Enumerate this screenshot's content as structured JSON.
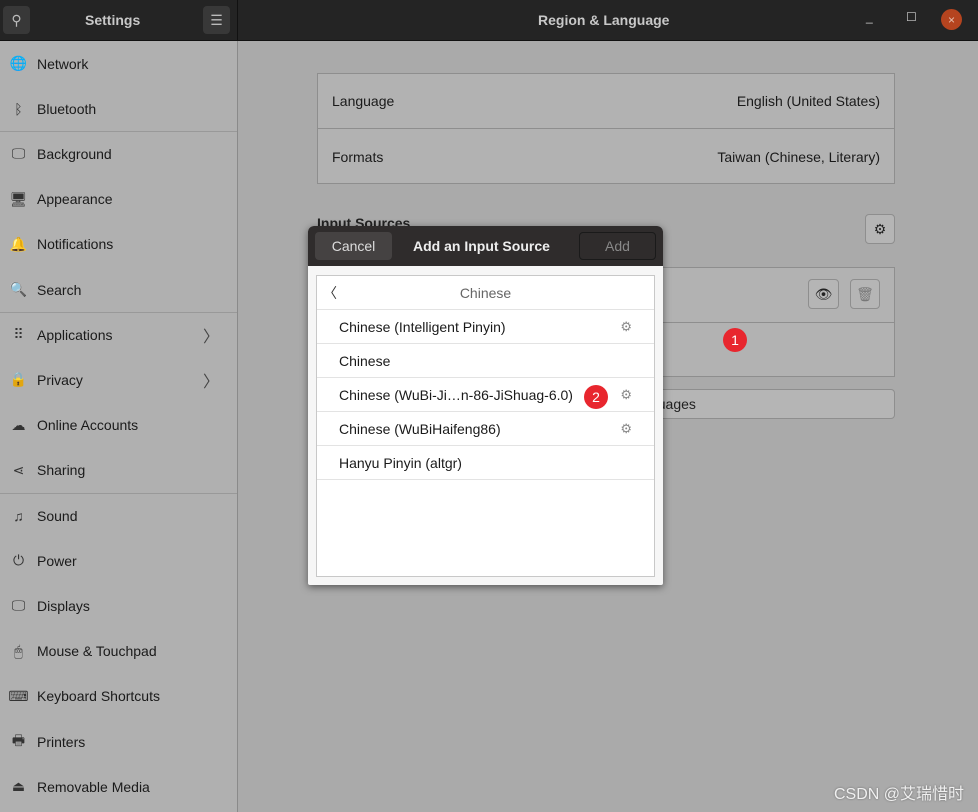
{
  "titlebar": {
    "app_title": "Settings",
    "panel_title": "Region & Language",
    "minimize": "_",
    "maximize": "☐",
    "close": "×"
  },
  "sidebar": {
    "items": [
      {
        "label": "Network",
        "icon": "🌐"
      },
      {
        "label": "Bluetooth",
        "icon": "ᛒ"
      },
      {
        "label": "Background",
        "icon": "🖵"
      },
      {
        "label": "Appearance",
        "icon": "🖥"
      },
      {
        "label": "Notifications",
        "icon": "🔔"
      },
      {
        "label": "Search",
        "icon": "🔍"
      },
      {
        "label": "Applications",
        "icon": "⠿",
        "chevron": "〉"
      },
      {
        "label": "Privacy",
        "icon": "🔒",
        "chevron": "〉"
      },
      {
        "label": "Online Accounts",
        "icon": "☁"
      },
      {
        "label": "Sharing",
        "icon": "⋖"
      },
      {
        "label": "Sound",
        "icon": "♫"
      },
      {
        "label": "Power",
        "icon": "⏻"
      },
      {
        "label": "Displays",
        "icon": "🖵"
      },
      {
        "label": "Mouse & Touchpad",
        "icon": "🖱"
      },
      {
        "label": "Keyboard Shortcuts",
        "icon": "⌨"
      },
      {
        "label": "Printers",
        "icon": "🖶"
      },
      {
        "label": "Removable Media",
        "icon": "⏏"
      }
    ]
  },
  "main": {
    "language_label": "Language",
    "language_value": "English (United States)",
    "formats_label": "Formats",
    "formats_value": "Taiwan (Chinese, Literary)",
    "input_sources_label": "Input Sources",
    "manage_languages": "Manage Installed Languages"
  },
  "dialog": {
    "cancel": "Cancel",
    "title": "Add an Input Source",
    "add": "Add",
    "back": "〈",
    "category": "Chinese",
    "items": [
      {
        "label": "Chinese (Intelligent Pinyin)",
        "settings": true
      },
      {
        "label": "Chinese",
        "settings": false
      },
      {
        "label": "Chinese (WuBi-Ji…n-86-JiShuag-6.0)",
        "settings": true
      },
      {
        "label": "Chinese (WuBiHaifeng86)",
        "settings": true
      },
      {
        "label": "Hanyu Pinyin (altgr)",
        "settings": false
      }
    ]
  },
  "annotations": {
    "badge1": "1",
    "badge2": "2"
  },
  "watermark": "CSDN @艾瑞惜时",
  "colors": {
    "titlebar": "#242424",
    "close": "#b5441f",
    "badge": "#e8262e"
  }
}
